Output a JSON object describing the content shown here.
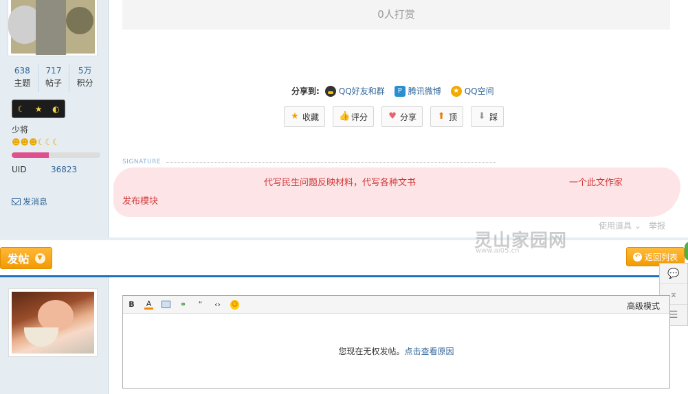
{
  "user1": {
    "stats": [
      {
        "num": "638",
        "label": "主题"
      },
      {
        "num": "717",
        "label": "帖子"
      },
      {
        "num": "5万",
        "label": "积分"
      }
    ],
    "rank_name": "少将",
    "uid_label": "UID",
    "uid_value": "36823",
    "send_message": "发消息",
    "progress_fraction": 0.42
  },
  "post": {
    "reward_text": "0人打赏",
    "share_label": "分享到:",
    "share_items": [
      "QQ好友和群",
      "腾讯微博",
      "QQ空间"
    ],
    "actions": [
      "收藏",
      "评分",
      "分享",
      "顶",
      "踩"
    ],
    "signature_label": "SIGNATURE",
    "signature_lines": [
      "代写民生问题反映材料，代写各种文书",
      "发布模块",
      "一个此文作家"
    ],
    "tools": "使用道具",
    "report": "举报"
  },
  "toolbar": {
    "post_button": "发帖",
    "back_button": "返回列表",
    "watermark": "灵山家园网",
    "watermark_url": "www.ai05.cn"
  },
  "editor": {
    "advanced": "高级模式",
    "no_permission": "您现在无权发帖。",
    "see_reason": "点击查看原因"
  },
  "colors": {
    "link": "#336699",
    "accent_orange": "#f29a03",
    "divider_blue": "#1f6fbf",
    "sidebar_bg": "#e5edf2"
  }
}
